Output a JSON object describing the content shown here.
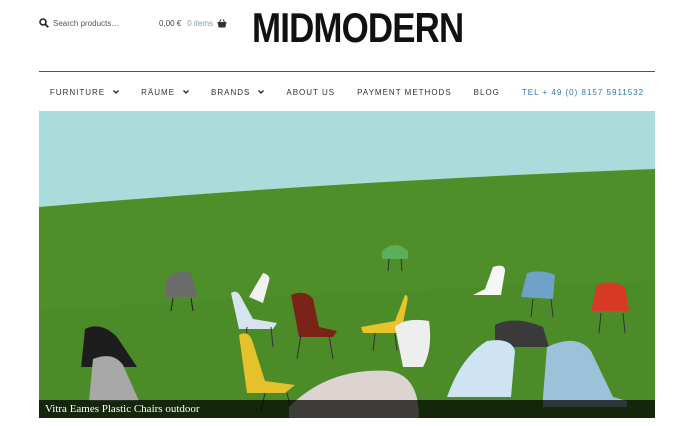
{
  "search": {
    "placeholder": "Search products…",
    "icon": "search-icon"
  },
  "cart": {
    "amount": "0,00 €",
    "items": "0 items",
    "icon": "basket-icon"
  },
  "logo": {
    "text": "MIDMODERN"
  },
  "nav": {
    "items": [
      {
        "label": "FURNITURE",
        "dropdown": true
      },
      {
        "label": "RÄUME",
        "dropdown": true
      },
      {
        "label": "BRANDS",
        "dropdown": true
      },
      {
        "label": "ABOUT US",
        "dropdown": false
      },
      {
        "label": "PAYMENT METHODS",
        "dropdown": false
      },
      {
        "label": "BLOG",
        "dropdown": false
      },
      {
        "label": "TEL + 49 (0) 8157 5911532",
        "dropdown": false
      }
    ]
  },
  "hero": {
    "caption": "Vitra Eames Plastic Chairs outdoor"
  },
  "colors": {
    "sky": "#a9dcda",
    "grass": "#4e8f2a",
    "link": "#2a7aa0"
  }
}
